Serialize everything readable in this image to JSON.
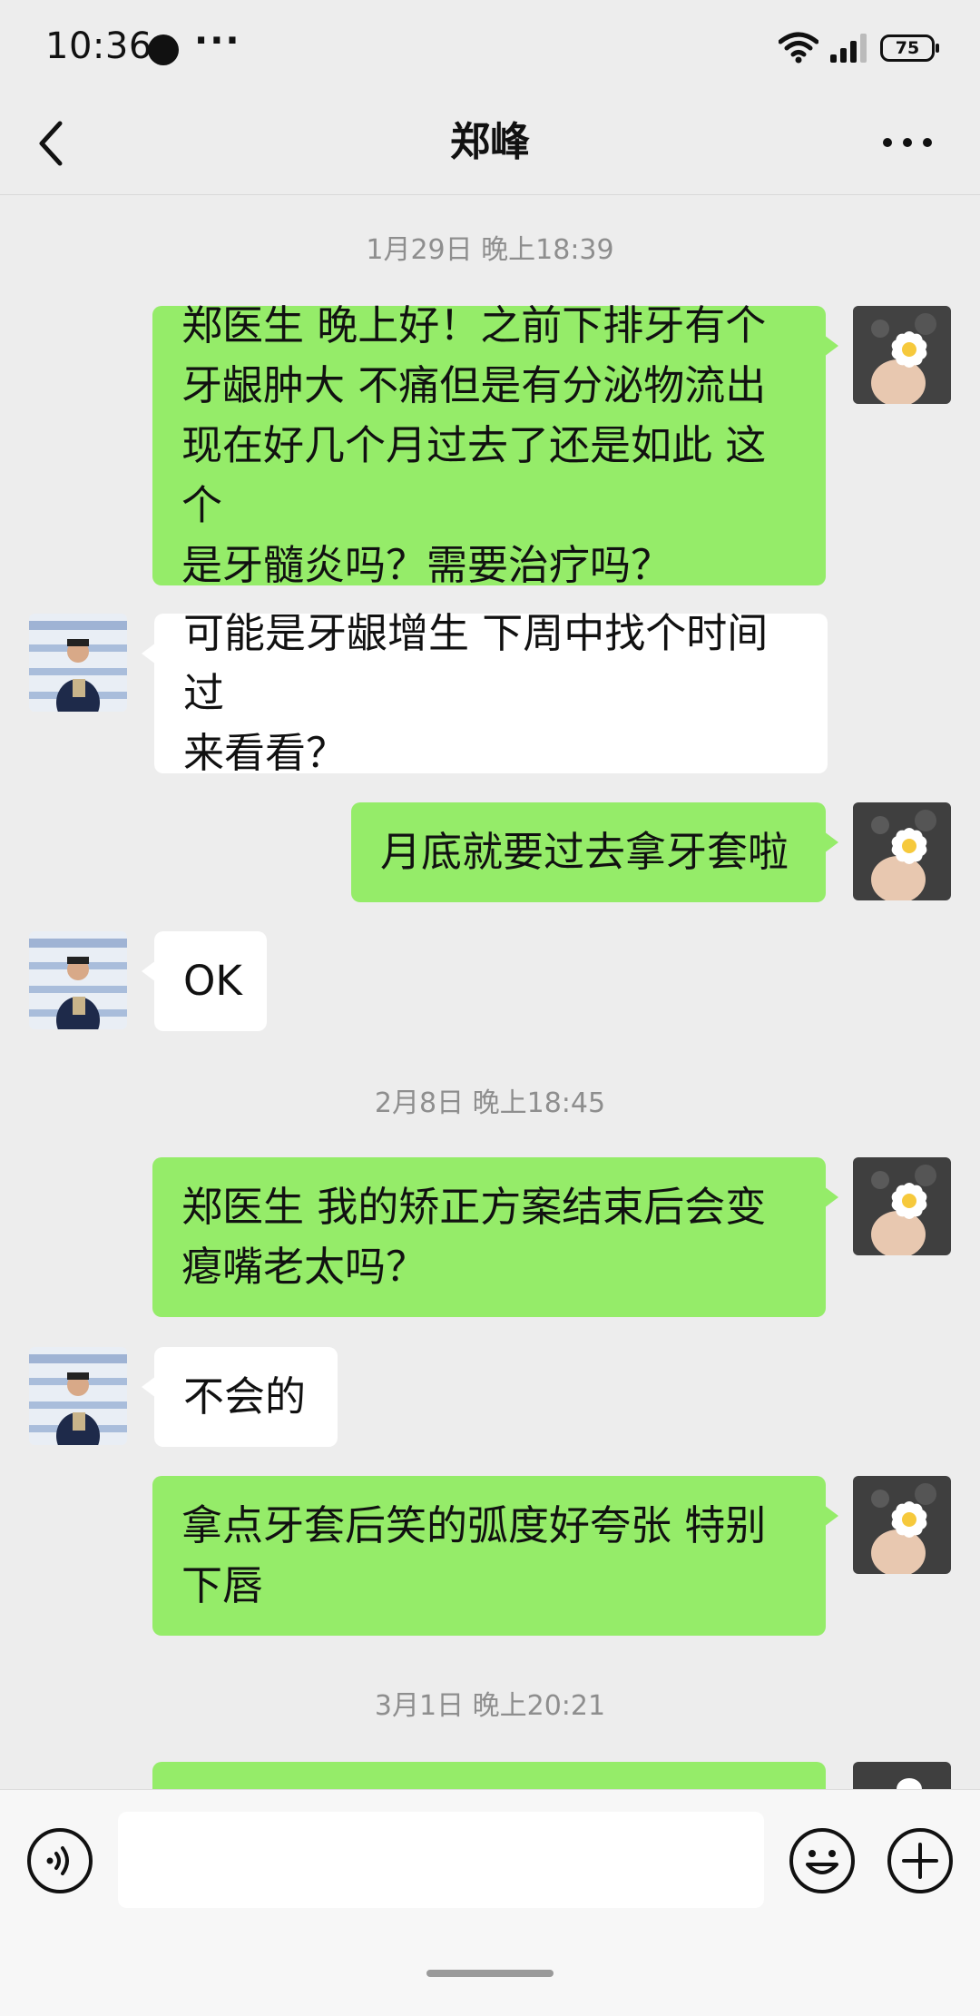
{
  "status_bar": {
    "time": "10:36",
    "more": "···",
    "battery": "75"
  },
  "header": {
    "title": "郑峰"
  },
  "timestamps": [
    "1月29日 晚上18:39",
    "2月8日 晚上18:45",
    "3月1日 晚上20:21"
  ],
  "messages": [
    {
      "sender": "me",
      "lines": [
        "郑医生  晚上好！之前下排牙有个",
        "牙龈肿大 不痛但是有分泌物流出",
        "现在好几个月过去了还是如此 这个",
        "是牙髓炎吗？需要治疗吗？"
      ]
    },
    {
      "sender": "them",
      "lines": [
        "可能是牙龈增生 下周中找个时间过",
        "来看看？"
      ]
    },
    {
      "sender": "me",
      "lines": [
        "月底就要过去拿牙套啦"
      ]
    },
    {
      "sender": "them",
      "lines": [
        "OK"
      ]
    },
    {
      "sender": "me",
      "lines": [
        "郑医生  我的矫正方案结束后会变",
        "瘪嘴老太吗？"
      ]
    },
    {
      "sender": "them",
      "lines": [
        "不会的"
      ]
    },
    {
      "sender": "me",
      "lines": [
        "拿点牙套后笑的弧度好夸张  特别",
        "下唇"
      ]
    }
  ],
  "colors": {
    "background": "#EDEDED",
    "my_bubble": "#95EC69",
    "their_bubble": "#FFFFFF",
    "timestamp": "#8E8E8E"
  },
  "icons": [
    "back-icon",
    "more-icon",
    "voice-icon",
    "emoji-icon",
    "plus-icon",
    "wifi-icon",
    "signal-icon",
    "battery-icon"
  ]
}
